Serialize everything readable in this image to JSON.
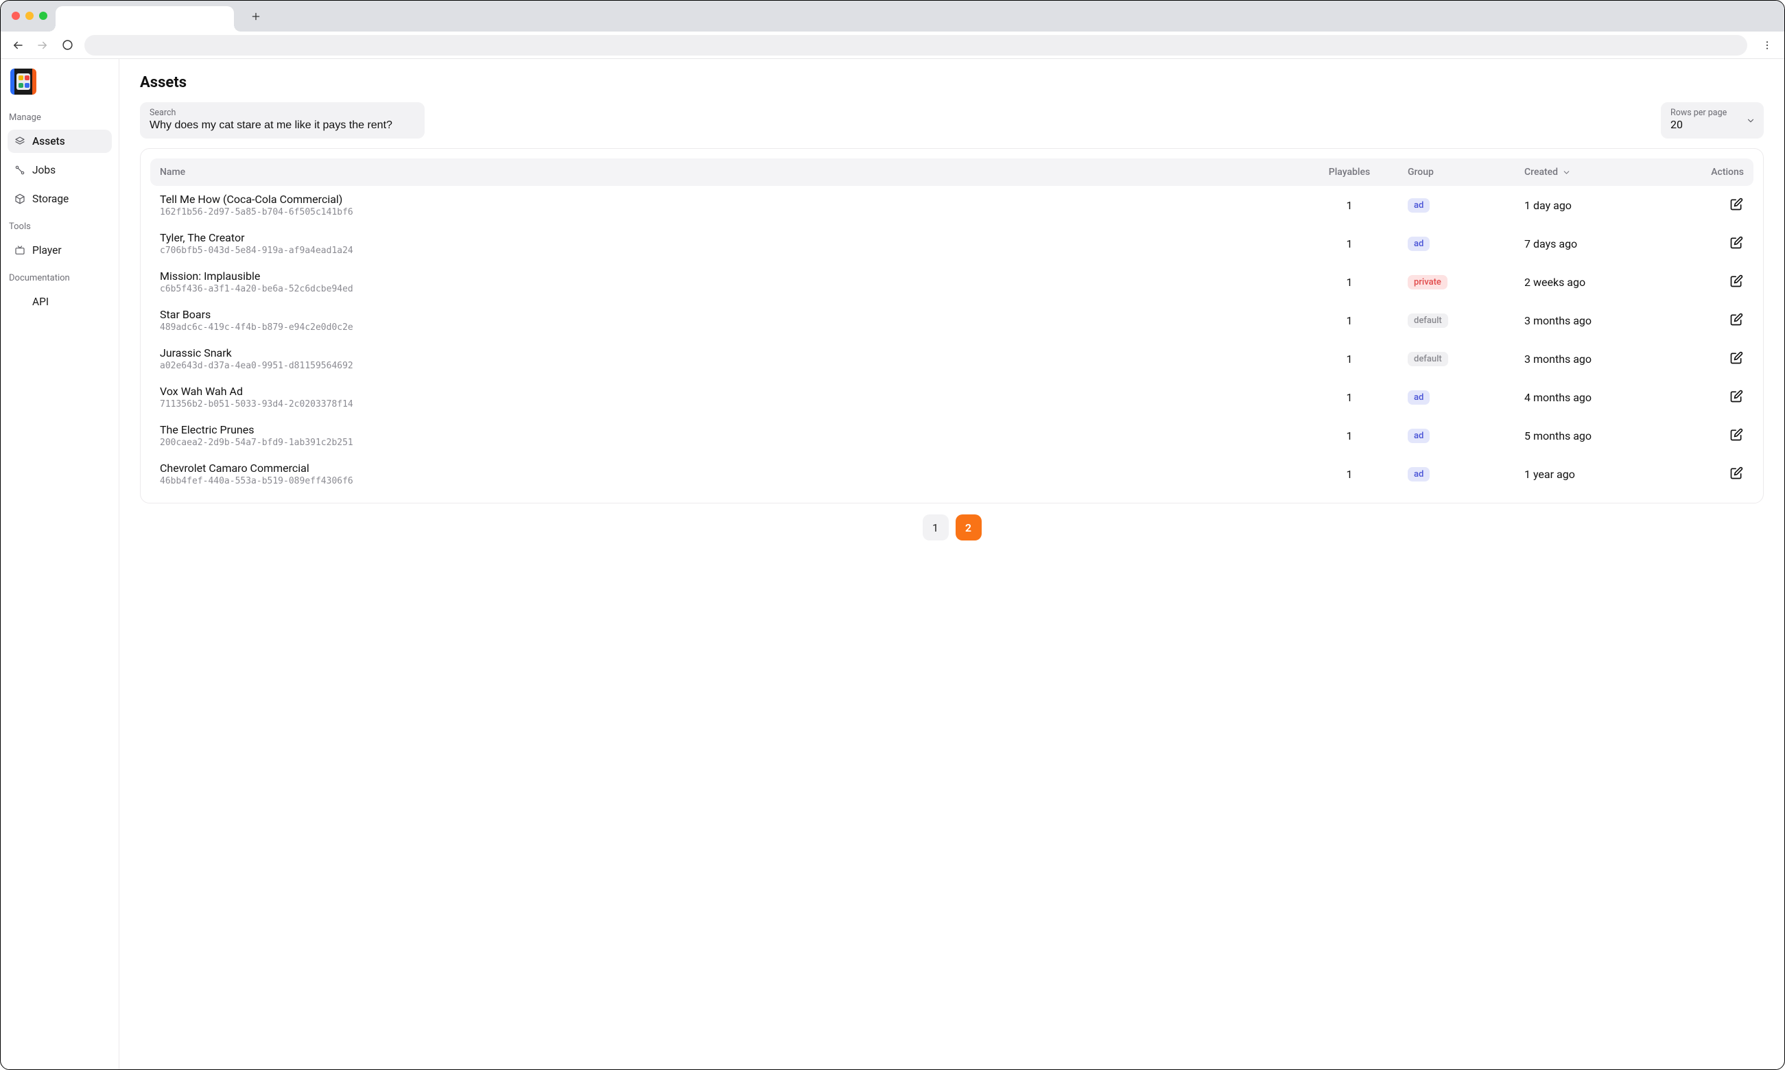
{
  "sidebar": {
    "sections": {
      "manage": {
        "label": "Manage",
        "items": [
          {
            "label": "Assets",
            "icon": "stack-icon",
            "active": true
          },
          {
            "label": "Jobs",
            "icon": "nodes-icon",
            "active": false
          },
          {
            "label": "Storage",
            "icon": "cube-icon",
            "active": false
          }
        ]
      },
      "tools": {
        "label": "Tools",
        "items": [
          {
            "label": "Player",
            "icon": "tv-icon",
            "active": false
          }
        ]
      },
      "documentation": {
        "label": "Documentation",
        "items": [
          {
            "label": "API",
            "icon": "",
            "active": false
          }
        ]
      }
    }
  },
  "page": {
    "title": "Assets"
  },
  "search": {
    "label": "Search",
    "value": "Why does my cat stare at me like it pays the rent?"
  },
  "rowsPerPage": {
    "label": "Rows per page",
    "value": "20"
  },
  "table": {
    "columns": {
      "name": "Name",
      "playables": "Playables",
      "group": "Group",
      "created": "Created",
      "actions": "Actions"
    },
    "rows": [
      {
        "name": "Tell Me How (Coca-Cola Commercial)",
        "id": "162f1b56-2d97-5a85-b704-6f505c141bf6",
        "playables": "1",
        "group": "ad",
        "created": "1 day ago"
      },
      {
        "name": "Tyler, The Creator",
        "id": "c706bfb5-043d-5e84-919a-af9a4ead1a24",
        "playables": "1",
        "group": "ad",
        "created": "7 days ago"
      },
      {
        "name": "Mission: Implausible",
        "id": "c6b5f436-a3f1-4a20-be6a-52c6dcbe94ed",
        "playables": "1",
        "group": "private",
        "created": "2 weeks ago"
      },
      {
        "name": "Star Boars",
        "id": "489adc6c-419c-4f4b-b879-e94c2e0d0c2e",
        "playables": "1",
        "group": "default",
        "created": "3 months ago"
      },
      {
        "name": "Jurassic Snark",
        "id": "a02e643d-d37a-4ea0-9951-d81159564692",
        "playables": "1",
        "group": "default",
        "created": "3 months ago"
      },
      {
        "name": "Vox Wah Wah Ad",
        "id": "711356b2-b051-5033-93d4-2c0203378f14",
        "playables": "1",
        "group": "ad",
        "created": "4 months ago"
      },
      {
        "name": "The Electric Prunes",
        "id": "200caea2-2d9b-54a7-bfd9-1ab391c2b251",
        "playables": "1",
        "group": "ad",
        "created": "5 months ago"
      },
      {
        "name": "Chevrolet Camaro Commercial",
        "id": "46bb4fef-440a-553a-b519-089eff4306f6",
        "playables": "1",
        "group": "ad",
        "created": "1 year ago"
      }
    ]
  },
  "pagination": {
    "pages": [
      "1",
      "2"
    ],
    "active": "2"
  }
}
